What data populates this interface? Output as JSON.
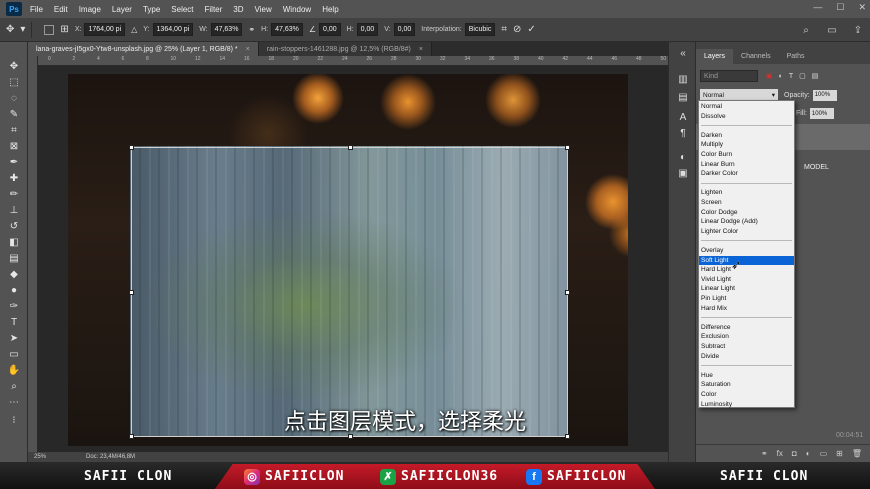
{
  "app": {
    "logo": "Ps"
  },
  "menu": [
    "File",
    "Edit",
    "Image",
    "Layer",
    "Type",
    "Select",
    "Filter",
    "3D",
    "View",
    "Window",
    "Help"
  ],
  "options": {
    "x_label": "X:",
    "x_value": "1764,00 pi",
    "y_label": "Y:",
    "y_value": "1364,00 pi",
    "w_label": "W:",
    "w_value": "47,63%",
    "h_label": "H:",
    "h_value": "47,63%",
    "angle_value": "0,00",
    "hskew_label": "H:",
    "hskew_value": "0,00",
    "vskew_label": "V:",
    "vskew_value": "0,00",
    "interp_label": "Interpolation:",
    "interp_value": "Bicubic"
  },
  "tabs": [
    {
      "label": "lana-graves-jI5gx0-Ytw8-unsplash.jpg @ 25% (Layer 1, RGB/8) *",
      "close": "×"
    },
    {
      "label": "rain-stoppers-1461288.jpg @ 12,5% (RGB/8#)",
      "close": "×"
    }
  ],
  "ruler_ticks": [
    "0",
    "2",
    "4",
    "6",
    "8",
    "10",
    "12",
    "14",
    "16",
    "18",
    "20",
    "22",
    "24",
    "26",
    "28",
    "30",
    "32",
    "34",
    "36",
    "38",
    "40",
    "42",
    "44",
    "46",
    "48",
    "50"
  ],
  "subtitle": "点击图层模式，选择柔光",
  "status": {
    "zoom": "25%",
    "doc": "Doc: 23,4M/46,8M"
  },
  "panel": {
    "tabs": [
      "Layers",
      "Channels",
      "Paths"
    ],
    "kind_placeholder": "Kind",
    "blend_value": "Normal",
    "opacity_label": "Opacity:",
    "opacity_value": "100%",
    "fill_label": "Fill:",
    "fill_value": "100%",
    "layer_label": "MODEL",
    "timecode": "00:04:51"
  },
  "blend_modes": {
    "groups": [
      [
        "Normal",
        "Dissolve"
      ],
      [
        "Darken",
        "Multiply",
        "Color Burn",
        "Linear Burn",
        "Darker Color"
      ],
      [
        "Lighten",
        "Screen",
        "Color Dodge",
        "Linear Dodge (Add)",
        "Lighter Color"
      ],
      [
        "Overlay",
        "Soft Light",
        "Hard Light",
        "Vivid Light",
        "Linear Light",
        "Pin Light",
        "Hard Mix"
      ],
      [
        "Difference",
        "Exclusion",
        "Subtract",
        "Divide"
      ],
      [
        "Hue",
        "Saturation",
        "Color",
        "Luminosity"
      ]
    ],
    "selected": "Soft Light"
  },
  "banner": {
    "left": "SAFII CLON",
    "instagram": "SAFIICLON",
    "other": "SAFIICLON36",
    "facebook": "SAFIICLON",
    "right": "SAFII CLON"
  },
  "colors": {
    "selection": "#0a64d6",
    "banner_red": "#c41a28"
  }
}
